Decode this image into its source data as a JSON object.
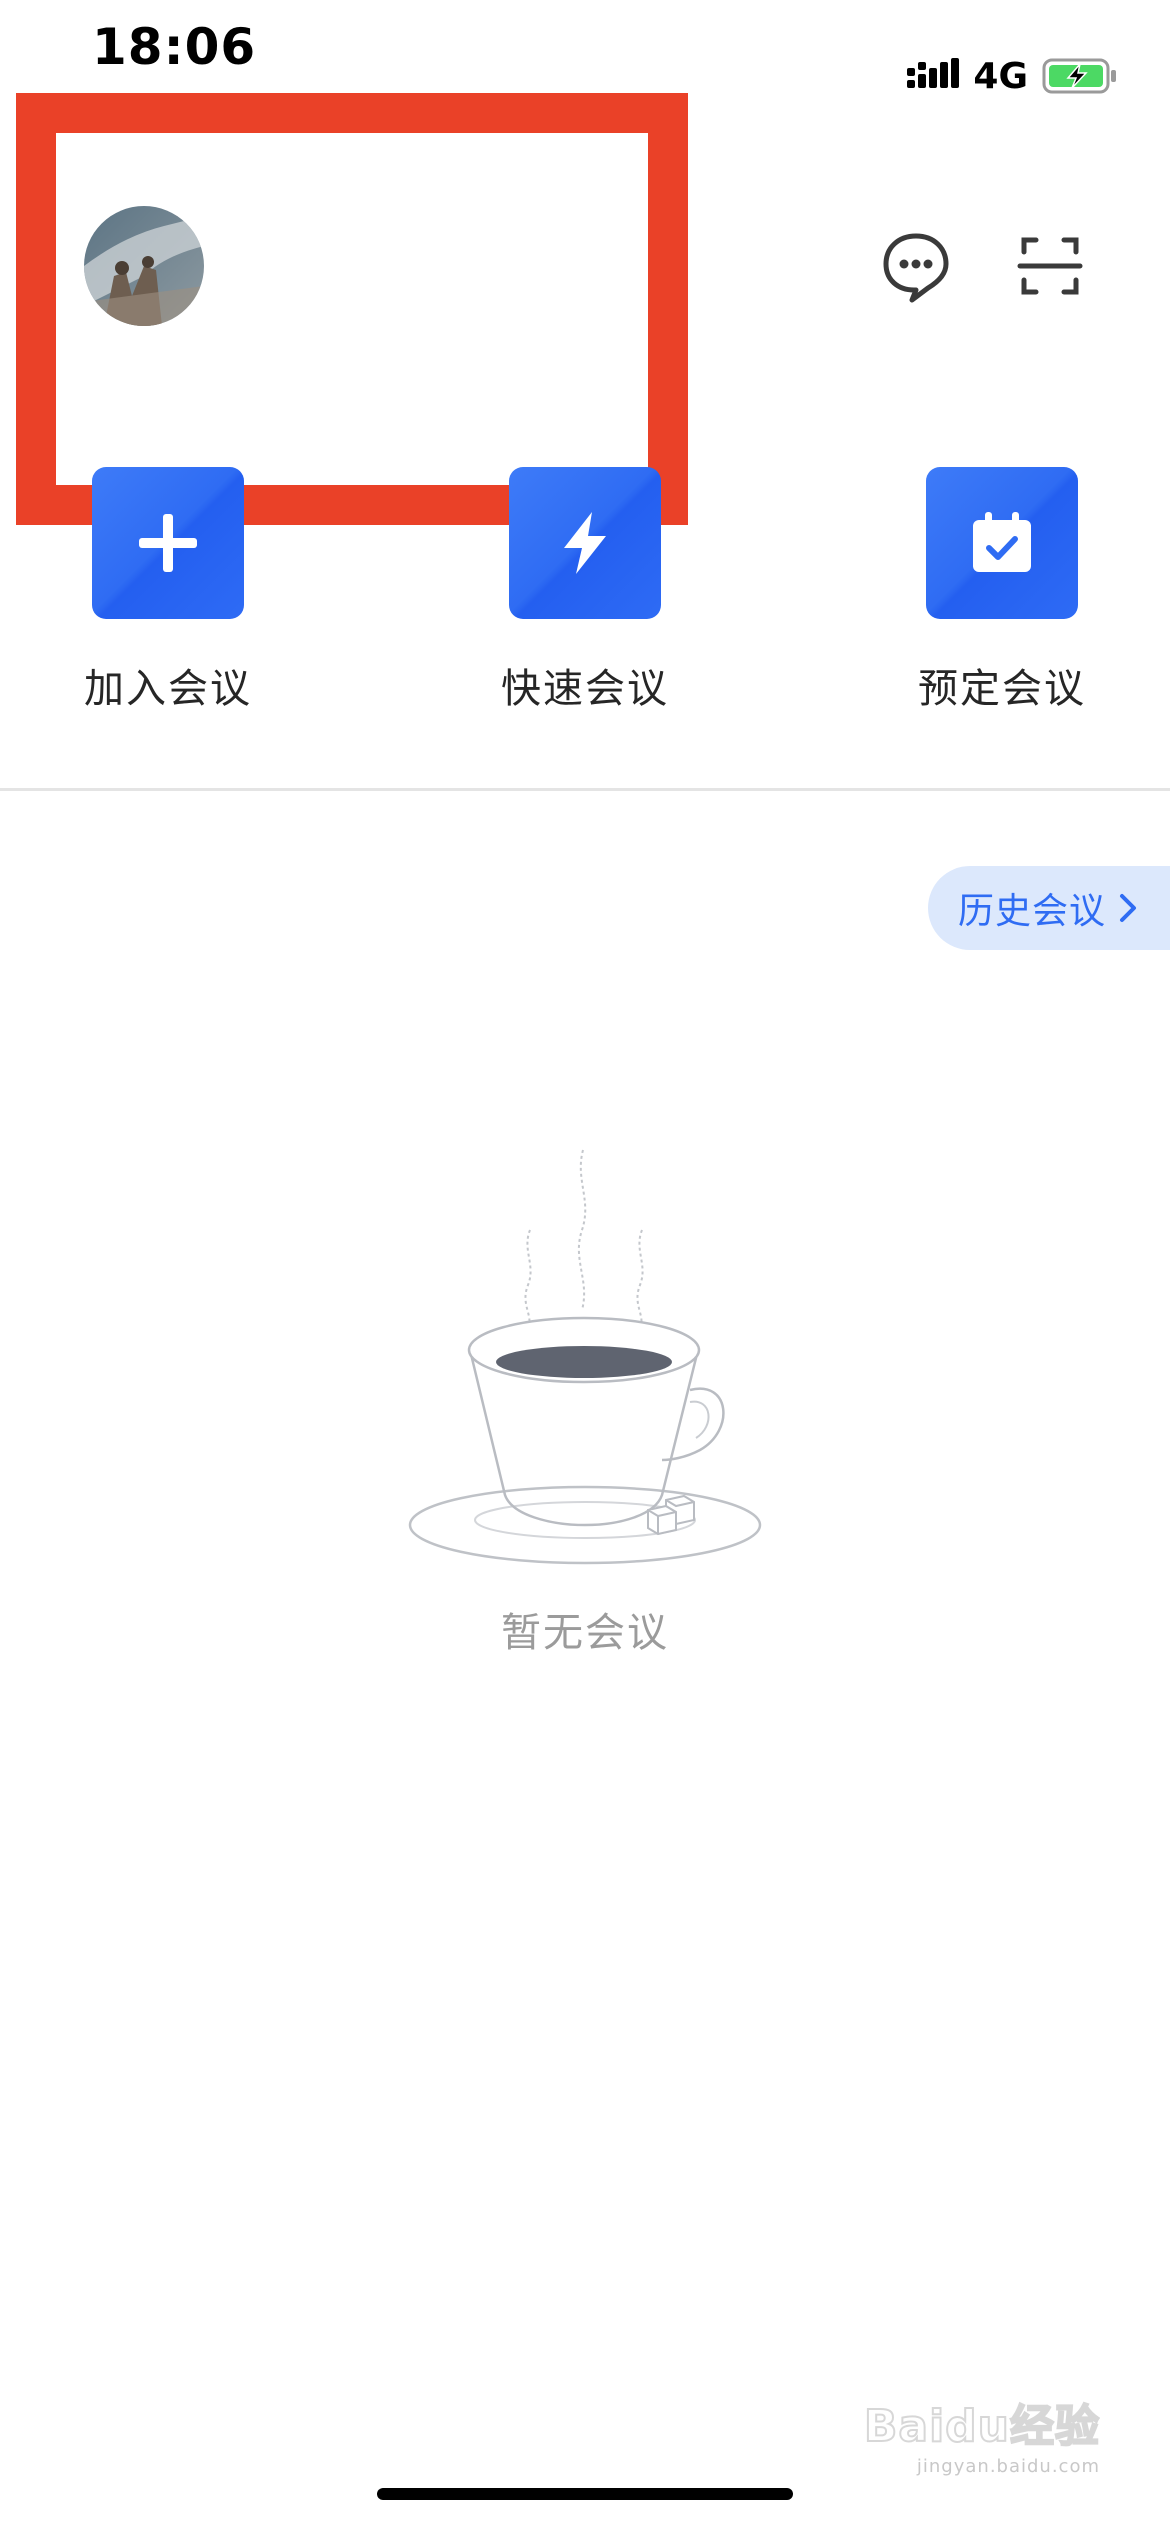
{
  "status_bar": {
    "time": "18:06",
    "network": "4G",
    "battery_color": "#4cd964"
  },
  "header": {
    "avatar_icon": "user-avatar-photo",
    "message_icon": "chat-bubble-icon",
    "scan_icon": "scan-icon",
    "annotation_color": "#ea4128"
  },
  "actions": [
    {
      "label": "加入会议",
      "icon": "plus-icon"
    },
    {
      "label": "快速会议",
      "icon": "lightning-icon"
    },
    {
      "label": "预定会议",
      "icon": "calendar-check-icon"
    }
  ],
  "history": {
    "label": "历史会议"
  },
  "empty_state": {
    "illustration_icon": "coffee-cup-icon",
    "text": "暂无会议"
  },
  "watermark": {
    "text": "Baidu经验",
    "sub": "jingyan.baidu.com"
  },
  "colors": {
    "accent": "#2f6cf3",
    "pill_bg": "#dce8fc"
  }
}
